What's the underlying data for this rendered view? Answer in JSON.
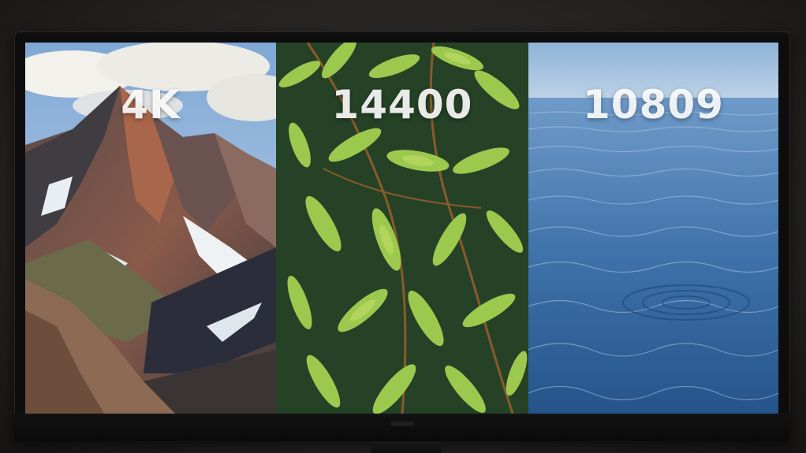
{
  "panels": [
    {
      "label": "4K",
      "scene": "mountain"
    },
    {
      "label": "14400",
      "scene": "fern-leaves"
    },
    {
      "label": "10809",
      "scene": "water"
    }
  ]
}
